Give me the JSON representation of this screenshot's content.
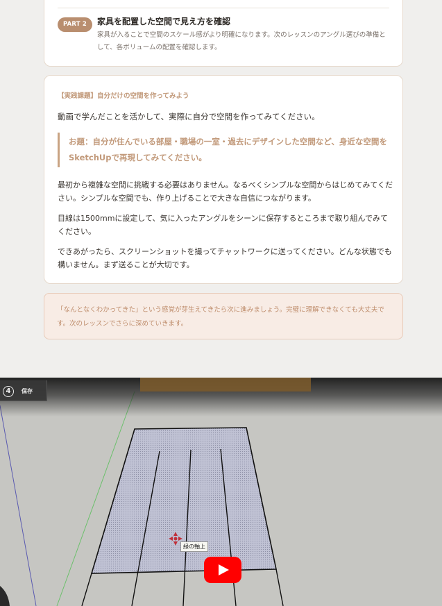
{
  "part2": {
    "badge": "PART 2",
    "title": "家具を配置した空間で見え方を確認",
    "description": "家具が入ることで空間のスケール感がより明確になります。次のレッスンのアングル選びの準備として、各ボリュームの配置を確認します。"
  },
  "practice": {
    "label": "【実践課題】自分だけの空間を作ってみよう",
    "intro": "動画で学んだことを活かして、実際に自分で空間を作ってみてください。",
    "assignment": "お題：自分が住んでいる部屋・職場の一室・過去にデザインした空間など、身近な空間をSketchUpで再現してみてください。",
    "paragraphs": [
      "最初から複雑な空間に挑戦する必要はありません。なるべくシンプルな空間からはじめてみてください。シンプルな空間でも、作り上げることで大きな自信につながります。",
      "目線は1500mmに設定して、気に入ったアングルをシーンに保存するところまで取り組んでみてください。",
      "できあがったら、スクリーンショットを撮ってチャットワークに送ってください。どんな状態でも構いません。まず送ることが大切です。"
    ]
  },
  "note": {
    "text": "「なんとなくわかってきた」という感覚が芽生えてきたら次に進みましょう。完璧に理解できなくても大丈夫です。次のレッスンでさらに深めていきます。"
  },
  "video": {
    "step_number": "4",
    "step_label": "保存",
    "axis_tooltip": "緑の軸上",
    "icons": {
      "play": "play-icon",
      "cursor": "move-cursor-icon"
    },
    "colors": {
      "play_button": "#ff0000",
      "green_axis": "#6cc06c",
      "blue_axis": "#5a5ab0",
      "floor": "#b9bbd0"
    }
  }
}
